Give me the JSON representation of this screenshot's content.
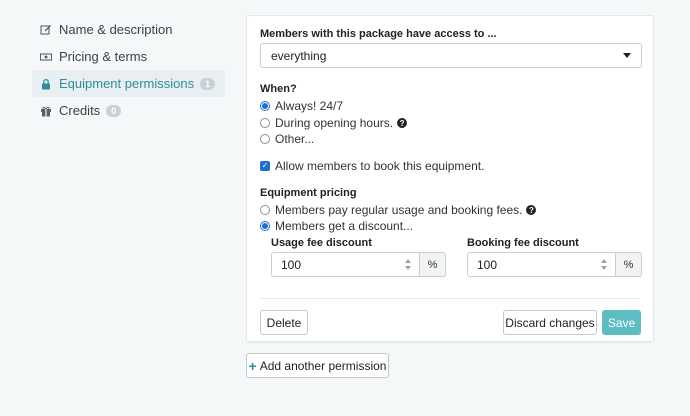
{
  "sidebar": {
    "items": [
      {
        "label": "Name & description",
        "icon": "edit-icon",
        "badge": null
      },
      {
        "label": "Pricing & terms",
        "icon": "money-icon",
        "badge": null
      },
      {
        "label": "Equipment permissions",
        "icon": "lock-icon",
        "badge": "1",
        "active": true
      },
      {
        "label": "Credits",
        "icon": "gift-icon",
        "badge": "0"
      }
    ]
  },
  "permission": {
    "access_label": "Members with this package have access to ...",
    "access_value": "everything",
    "when_label": "When?",
    "when_options": [
      "Always! 24/7",
      "During opening hours.",
      "Other..."
    ],
    "when_selected": 0,
    "allow_booking_label": "Allow members to book this equipment.",
    "allow_booking_checked": true,
    "pricing_label": "Equipment pricing",
    "pricing_options": [
      "Members pay regular usage and booking fees.",
      "Members get a discount..."
    ],
    "pricing_selected": 1,
    "usage_fee_label": "Usage fee discount",
    "usage_fee_value": "100",
    "booking_fee_label": "Booking fee discount",
    "booking_fee_value": "100",
    "percent_unit": "%",
    "delete_label": "Delete",
    "discard_label": "Discard changes",
    "save_label": "Save"
  },
  "add_permission_label": "Add another permission",
  "colors": {
    "accent": "#2e8f96",
    "save_button": "#5dbdc3",
    "radio_checked": "#1f6fd1"
  }
}
